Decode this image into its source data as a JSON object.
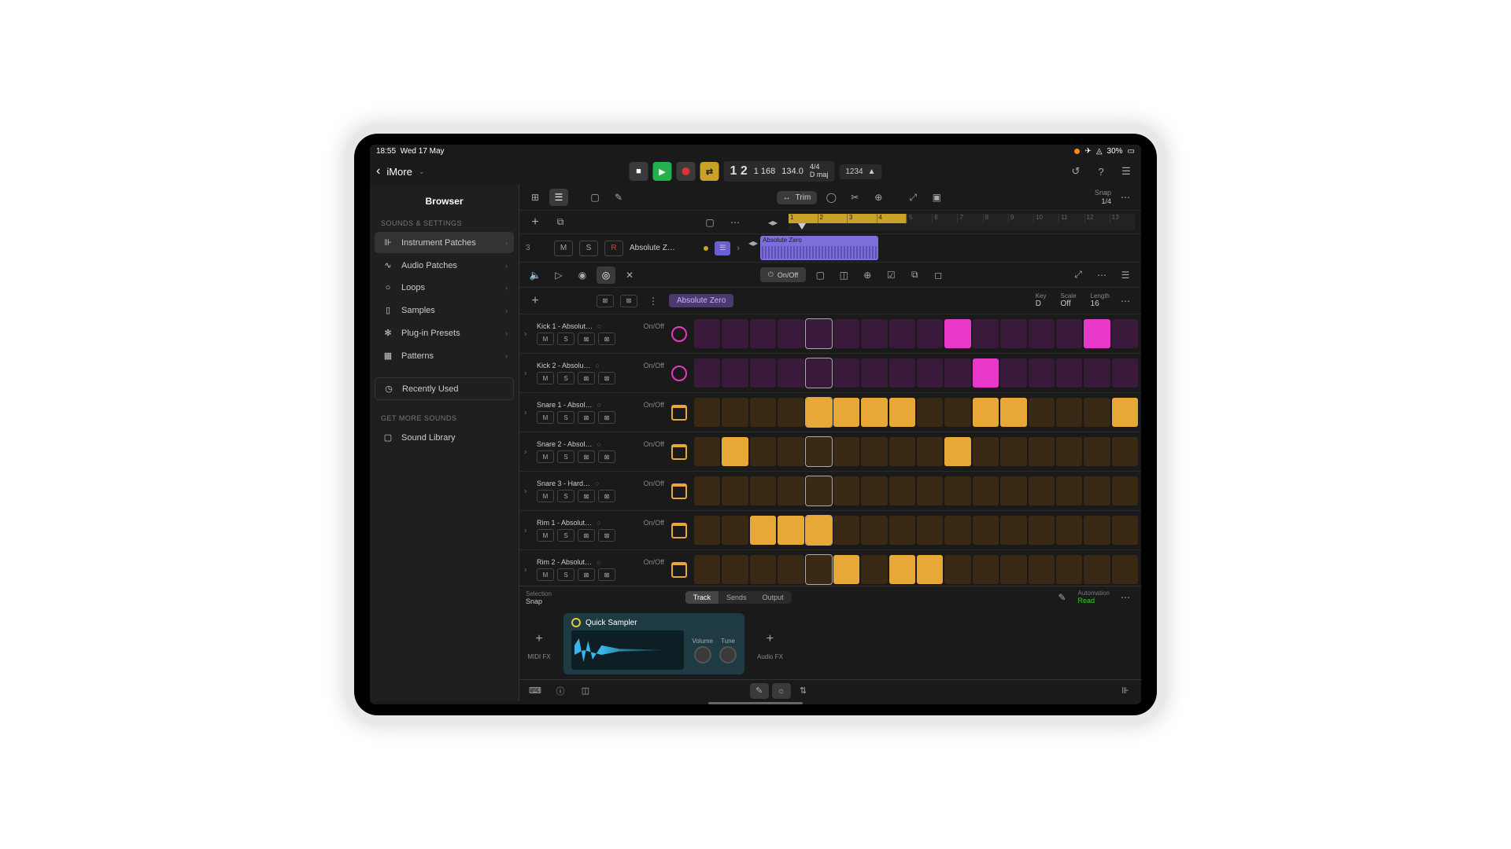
{
  "status": {
    "time": "18:55",
    "date": "Wed 17 May",
    "battery": "30%"
  },
  "project": {
    "name": "iMore"
  },
  "transport": {
    "bar_beat": "1 2",
    "position": "1 168",
    "tempo": "134.0",
    "sig_top": "4/4",
    "sig_key": "D maj",
    "locator": "1234"
  },
  "snap": {
    "label": "Snap",
    "value": "1/4"
  },
  "browser": {
    "title": "Browser",
    "heading_sounds": "SOUNDS & SETTINGS",
    "heading_more": "GET MORE SOUNDS",
    "items": [
      {
        "label": "Instrument Patches"
      },
      {
        "label": "Audio Patches"
      },
      {
        "label": "Loops"
      },
      {
        "label": "Samples"
      },
      {
        "label": "Plug-in Presets"
      },
      {
        "label": "Patterns"
      }
    ],
    "recent": "Recently Used",
    "library": "Sound Library"
  },
  "trim_label": "Trim",
  "track": {
    "number": "3",
    "m": "M",
    "s": "S",
    "r": "R",
    "name": "Absolute Z…",
    "region_name": "Absolute Zero"
  },
  "ruler": {
    "yellow": [
      "1",
      "2",
      "3",
      "4"
    ],
    "rest": [
      "5",
      "6",
      "7",
      "8",
      "9",
      "10",
      "11",
      "12",
      "13"
    ]
  },
  "step": {
    "onoff": "On/Off",
    "pattern": "Absolute Zero",
    "key_label": "Key",
    "key_val": "D",
    "scale_label": "Scale",
    "scale_val": "Off",
    "length_label": "Length",
    "length_val": "16",
    "m": "M",
    "s": "S",
    "onoff_short": "On/Off",
    "rows": [
      {
        "name": "Kick 1 - Absolut…",
        "type": "kick",
        "cells": [
          0,
          0,
          0,
          0,
          0,
          0,
          0,
          0,
          0,
          1,
          0,
          0,
          0,
          0,
          1,
          0
        ]
      },
      {
        "name": "Kick 2 - Absolu…",
        "type": "kick",
        "cells": [
          0,
          0,
          0,
          0,
          0,
          0,
          0,
          0,
          0,
          0,
          1,
          0,
          0,
          0,
          0,
          0
        ]
      },
      {
        "name": "Snare 1 - Absol…",
        "type": "snare",
        "cells": [
          0,
          0,
          0,
          0,
          1,
          1,
          1,
          1,
          0,
          0,
          1,
          1,
          0,
          0,
          0,
          1
        ]
      },
      {
        "name": "Snare 2 - Absol…",
        "type": "snare",
        "cells": [
          0,
          1,
          0,
          0,
          0,
          0,
          0,
          0,
          0,
          1,
          0,
          0,
          0,
          0,
          0,
          0
        ]
      },
      {
        "name": "Snare 3 - Hard…",
        "type": "snare",
        "cells": [
          0,
          0,
          0,
          0,
          0,
          0,
          0,
          0,
          0,
          0,
          0,
          0,
          0,
          0,
          0,
          0
        ]
      },
      {
        "name": "Rim 1 - Absolut…",
        "type": "snare",
        "cells": [
          0,
          0,
          1,
          1,
          1,
          0,
          0,
          0,
          0,
          0,
          0,
          0,
          0,
          0,
          0,
          0
        ]
      },
      {
        "name": "Rim 2 - Absolut…",
        "type": "snare",
        "cells": [
          0,
          0,
          0,
          0,
          0,
          1,
          0,
          1,
          1,
          0,
          0,
          0,
          0,
          0,
          0,
          0
        ]
      }
    ]
  },
  "selection": {
    "label": "Selection",
    "value": "Snap"
  },
  "mixer_tabs": {
    "track": "Track",
    "sends": "Sends",
    "output": "Output"
  },
  "automation": {
    "label": "Automation",
    "value": "Read"
  },
  "fx": {
    "midi": "MIDI FX",
    "audio": "Audio FX"
  },
  "sampler": {
    "title": "Quick Sampler",
    "volume": "Volume",
    "tune": "Tune"
  }
}
